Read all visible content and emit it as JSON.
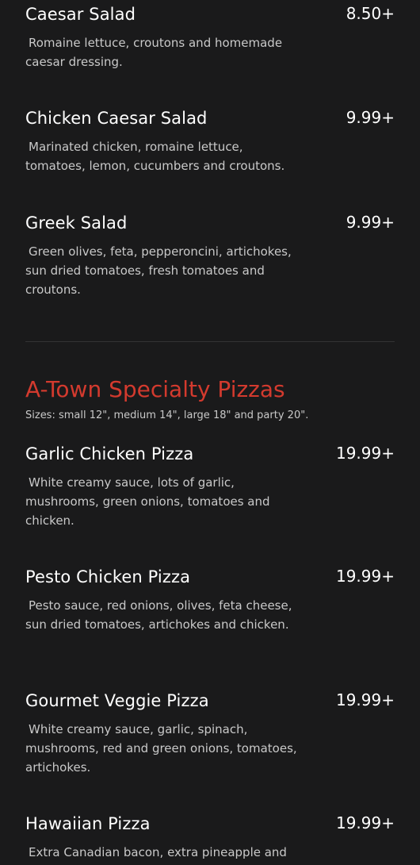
{
  "salads": [
    {
      "name": "Caesar Salad",
      "price": "8.50+",
      "description": "Romaine lettuce, croutons and homemade caesar dressing."
    },
    {
      "name": "Chicken Caesar Salad",
      "price": "9.99+",
      "description": "Marinated chicken, romaine lettuce, tomatoes, lemon, cucumbers and croutons."
    },
    {
      "name": "Greek Salad",
      "price": "9.99+",
      "description": "Green olives, feta, pepperoncini, artichokes, sun dried tomatoes, fresh tomatoes and croutons."
    }
  ],
  "pizza_section": {
    "title": "A-Town Specialty Pizzas",
    "subtitle": "Sizes: small 12\", medium 14\", large 18\" and party 20\"."
  },
  "pizzas": [
    {
      "name": "Garlic Chicken Pizza",
      "price": "19.99+",
      "description": "White creamy sauce, lots of garlic, mushrooms, green onions, tomatoes and chicken."
    },
    {
      "name": "Pesto Chicken Pizza",
      "price": "19.99+",
      "description": "Pesto sauce, red onions, olives, feta cheese, sun dried tomatoes, artichokes and chicken."
    },
    {
      "name": "Gourmet Veggie Pizza",
      "price": "19.99+",
      "description": "White creamy sauce, garlic, spinach, mushrooms, red and green onions, tomatoes, artichokes."
    },
    {
      "name": "Hawaiian Pizza",
      "price": "19.99+",
      "description": "Extra Canadian bacon, extra pineapple and"
    }
  ],
  "colors": {
    "background": "#1a1a1b",
    "accent": "#d33a2e",
    "text": "#ffffff",
    "muted_text": "#c9c9c9"
  }
}
